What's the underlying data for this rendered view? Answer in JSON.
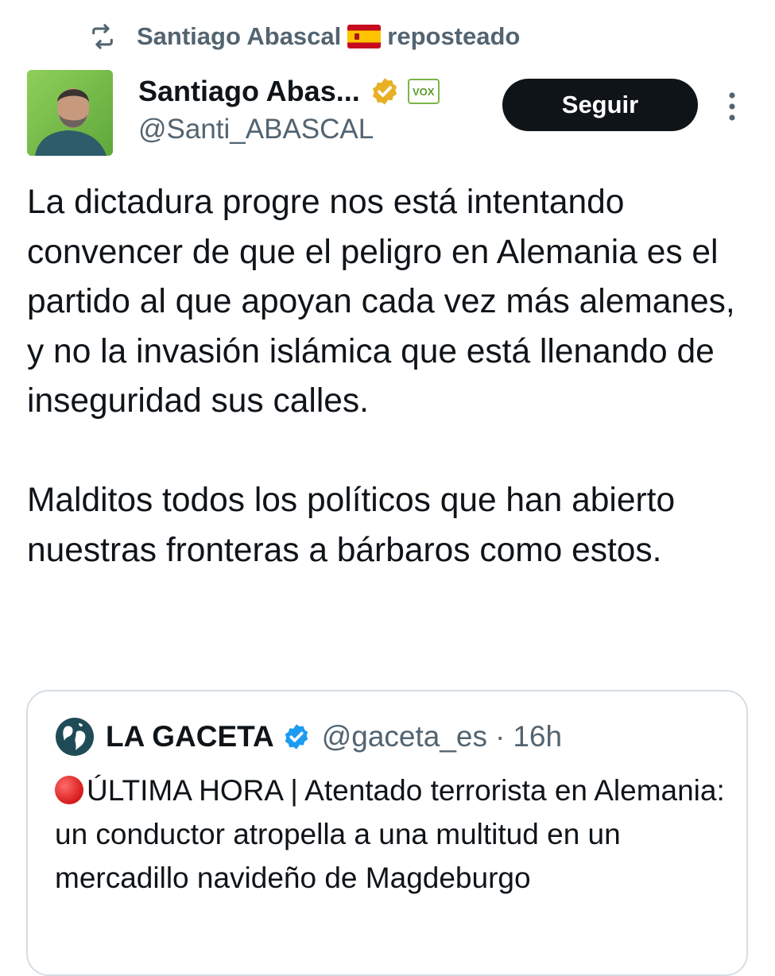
{
  "repost": {
    "icon": "repost-icon",
    "user": "Santiago Abascal",
    "flag": "🇪🇸",
    "label": "reposteado"
  },
  "author": {
    "display_name": "Santiago Abas...",
    "handle": "@Santi_ABASCAL",
    "verified_badge": "gold-verified-badge-icon",
    "affiliation_badge": "VOX",
    "avatar": "avatar"
  },
  "follow_button": {
    "label": "Seguir"
  },
  "more_menu": {
    "icon": "more-vertical-icon"
  },
  "tweet": {
    "paragraph_1": "La dictadura progre nos está intentando convencer de que el peligro en Alemania es el partido al que apoyan cada vez más alemanes, y no la invasión islámica que está llenando de inseguridad sus calles.",
    "paragraph_2": "Malditos todos los políticos que han abierto nuestras fronteras a bárbaros como estos."
  },
  "quoted": {
    "display_name": "LA GACETA",
    "handle": "@gaceta_es",
    "separator": "·",
    "time": "16h",
    "text_prefix": "🔴",
    "text": "ÚLTIMA HORA | Atentado terrorista en Alemania: un conductor atropella a una multitud en un mercadillo navideño de Magdeburgo"
  },
  "colors": {
    "text_primary": "#0f1419",
    "text_secondary": "#536471",
    "button_bg": "#0f1419",
    "gold_badge": "#e8b125",
    "blue_badge": "#1d9bf0",
    "border": "#d6dde3"
  }
}
